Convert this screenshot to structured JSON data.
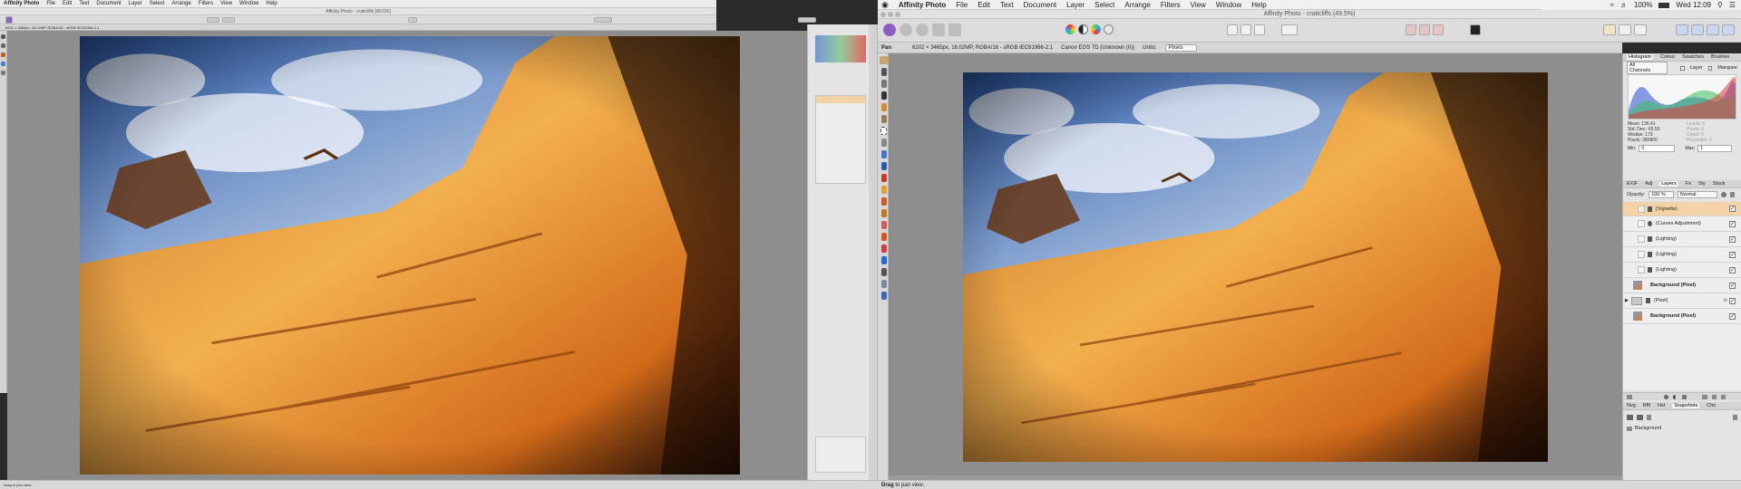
{
  "left_window": {
    "menu": {
      "app": "Affinity Photo",
      "items": [
        "File",
        "Edit",
        "Text",
        "Document",
        "Layer",
        "Select",
        "Arrange",
        "Filters",
        "View",
        "Window",
        "Help"
      ]
    },
    "title": "Affinity Photo - craitcliffs [49.5%]",
    "status_text": "Drag to pan view."
  },
  "right_window": {
    "menu": {
      "apple": "",
      "app": "Affinity Photo",
      "items": [
        "File",
        "Edit",
        "Text",
        "Document",
        "Layer",
        "Select",
        "Arrange",
        "Filters",
        "View",
        "Window",
        "Help"
      ],
      "status": {
        "battery": "100%",
        "clock": "Wed 12:09"
      }
    },
    "title": "Affinity Photo - craitcliffs (49.5%)",
    "context": {
      "tool": "Pan",
      "doc_info": "6202 × 3465px, 18.02MP, RGBA/16 - sRGB IEC61966-2.1",
      "camera": "Canon EOS 7D (Unknown (0))",
      "units_label": "Units:",
      "units_value": "Pixels"
    },
    "histogram": {
      "tabs": [
        "Histogram",
        "Colour",
        "Swatches",
        "Brushes"
      ],
      "channel": "All Channels",
      "layer_label": "Layer",
      "marquee_label": "Marquee",
      "stats": [
        "Mean: 136.41",
        "Std. Dev.: 65.55",
        "Median: 173",
        "Pixels: 280800"
      ],
      "stats_right": [
        "Levels: 0",
        "Pixels: 0",
        "Count: 0",
        "Percentile: 0"
      ],
      "min_label": "Min:",
      "min_value": "0",
      "max_label": "Max:",
      "max_value": "1"
    },
    "layers": {
      "tabs": [
        "EXIF",
        "Adj",
        "Layers",
        "Fx",
        "Sty",
        "Stock"
      ],
      "opacity_label": "Opacity:",
      "opacity_value": "100 %",
      "blend_mode": "Normal",
      "items": [
        {
          "name": "(Vignette)",
          "selected": true
        },
        {
          "name": "(Curves Adjustment)",
          "selected": false
        },
        {
          "name": "(Lighting)",
          "selected": false
        },
        {
          "name": "(Lighting)",
          "selected": false
        },
        {
          "name": "(Lighting)",
          "selected": false
        },
        {
          "name": "Background (Pixel)",
          "selected": false
        },
        {
          "name": "(Pixel)",
          "selected": false
        },
        {
          "name": "Background (Pixel)",
          "selected": false
        }
      ],
      "fx_label": "fx"
    },
    "history": {
      "tabs": [
        "Nvg",
        "Rflt",
        "Hst",
        "Snapshots",
        "Chn"
      ],
      "items": [
        "Background"
      ]
    },
    "status_text_bold": "Drag",
    "status_text": "to pan view."
  },
  "colors": {
    "accent": "#f3d3a6",
    "canvas": "#8e8e8e",
    "panel": "#e4e4e4"
  }
}
